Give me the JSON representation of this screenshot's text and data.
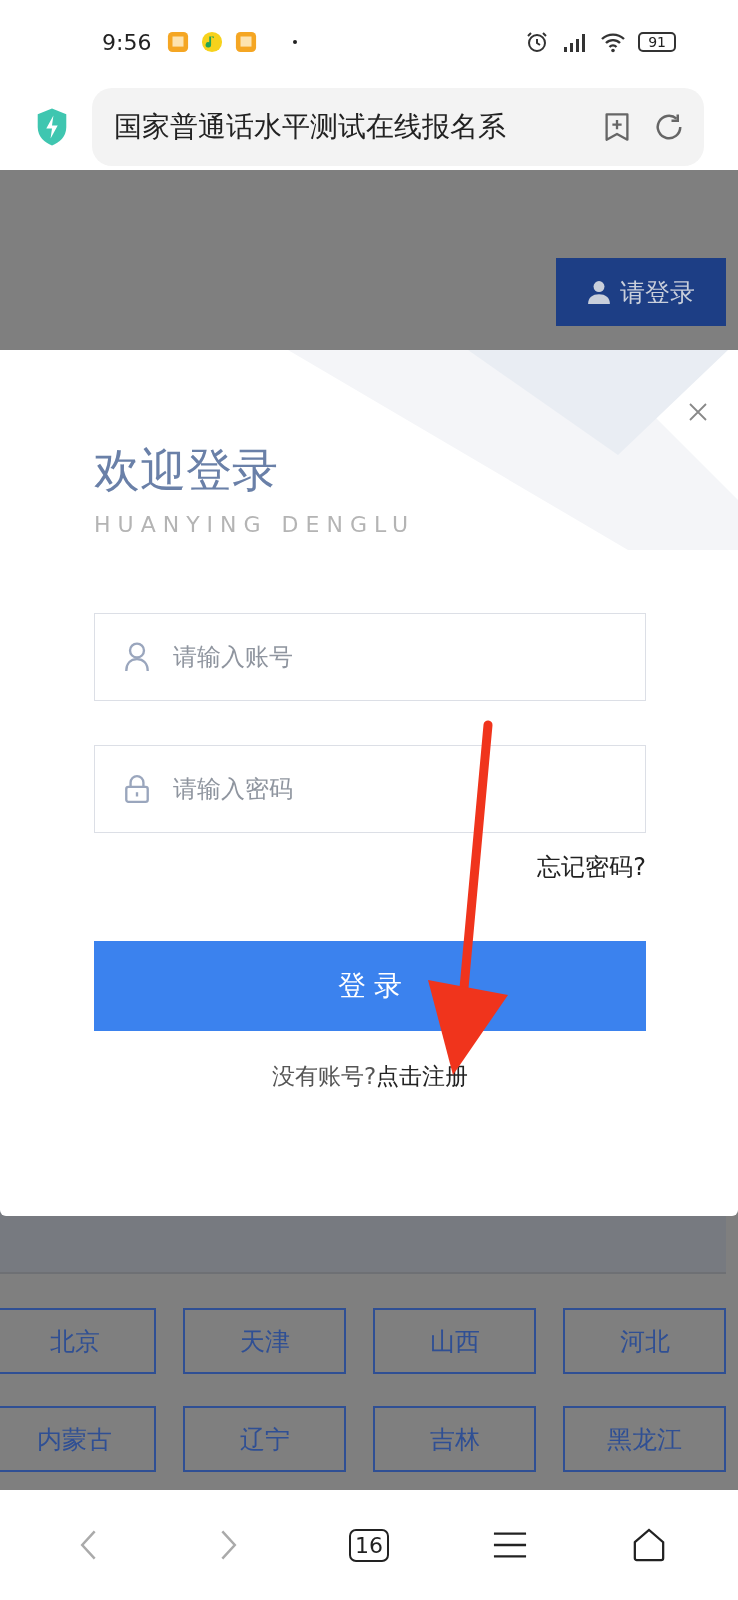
{
  "status_bar": {
    "time": "9:56",
    "battery": "91"
  },
  "address_bar": {
    "title": "国家普通话水平测试在线报名系"
  },
  "page": {
    "login_button": "请登录",
    "provinces": [
      "北京",
      "天津",
      "山西",
      "河北",
      "内蒙古",
      "辽宁",
      "吉林",
      "黑龙江"
    ]
  },
  "login_dialog": {
    "title": "欢迎登录",
    "subtitle": "HUANYING DENGLU",
    "fields": [
      {
        "kind": "user",
        "placeholder": "请输入账号"
      },
      {
        "kind": "lock",
        "placeholder": "请输入密码"
      }
    ],
    "forgot_link": "忘记密码?",
    "submit_button": "登 录",
    "register_prompt": "没有账号?",
    "register_link": "点击注册"
  },
  "bottom_nav": {
    "tab_count": "16"
  }
}
